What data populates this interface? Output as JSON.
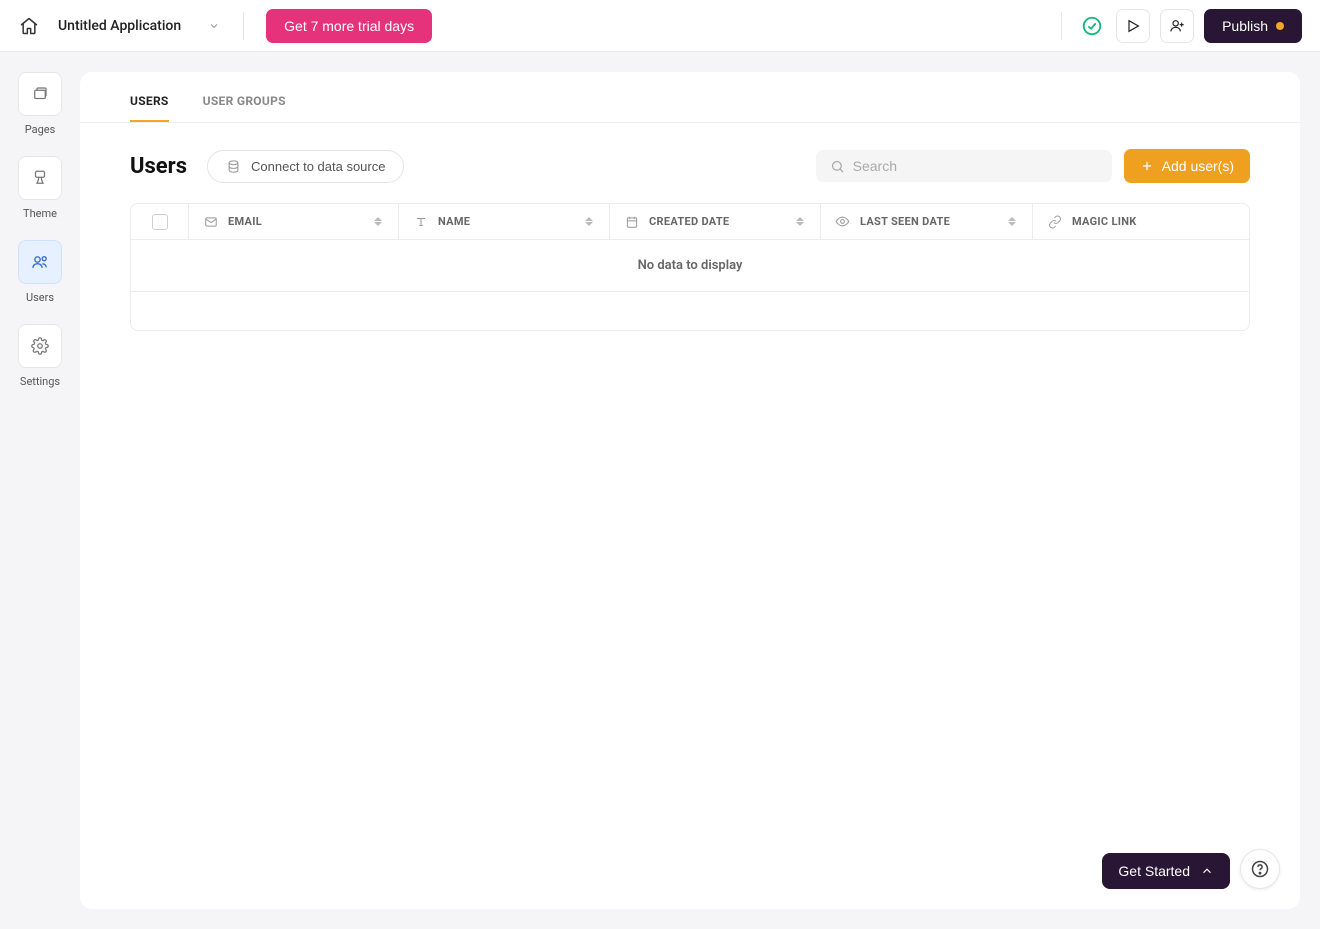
{
  "topbar": {
    "app_name": "Untitled Application",
    "trial_btn": "Get 7 more trial days",
    "publish_btn": "Publish"
  },
  "sidebar": {
    "items": [
      {
        "label": "Pages"
      },
      {
        "label": "Theme"
      },
      {
        "label": "Users"
      },
      {
        "label": "Settings"
      }
    ]
  },
  "tabs": {
    "users": "USERS",
    "user_groups": "USER GROUPS"
  },
  "page": {
    "title": "Users",
    "connect_btn": "Connect to data source",
    "search_placeholder": "Search",
    "add_btn": "Add user(s)"
  },
  "table": {
    "headers": {
      "email": "EMAIL",
      "name": "NAME",
      "created": "CREATED DATE",
      "lastseen": "LAST SEEN DATE",
      "magic": "MAGIC LINK"
    },
    "empty": "No data to display"
  },
  "floating": {
    "get_started": "Get Started"
  }
}
